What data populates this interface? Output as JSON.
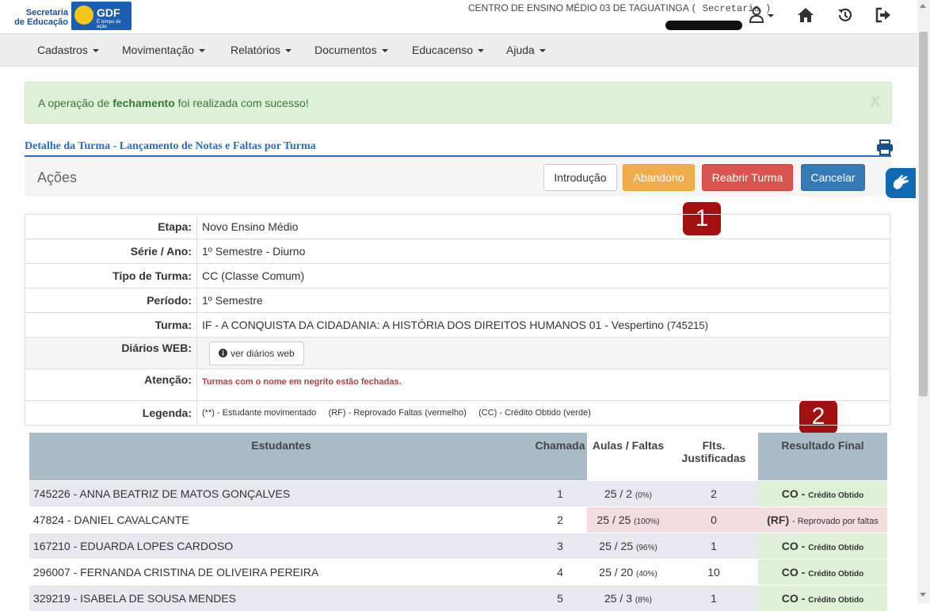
{
  "header": {
    "logo_secretaria_line1": "Secretaria",
    "logo_secretaria_line2": "de Educação",
    "logo_gdf": "GDF",
    "logo_gdf_tagline": "É tempo de ação",
    "school_name": "CENTRO DE ENSINO MÉDIO 03 DE TAGUATINGA",
    "role": "( Secretaria )"
  },
  "nav": [
    {
      "label": "Cadastros"
    },
    {
      "label": "Movimentação"
    },
    {
      "label": "Relatórios"
    },
    {
      "label": "Documentos"
    },
    {
      "label": "Educacenso"
    },
    {
      "label": "Ajuda"
    }
  ],
  "alert": {
    "prefix": "A operação de ",
    "bold": "fechamento",
    "suffix": " foi realizada com sucesso!",
    "close": "X"
  },
  "section_title": "Detalhe da Turma - Lançamento de Notas e Faltas por Turma",
  "actions": {
    "label": "Ações",
    "introducao": "Introdução",
    "abandono": "Abandono",
    "reabrir": "Reabrir Turma",
    "cancelar": "Cancelar"
  },
  "badges": {
    "one": "1",
    "two": "2"
  },
  "info": {
    "etapa_label": "Etapa:",
    "etapa": "Novo Ensino Médio",
    "serie_label": "Série / Ano:",
    "serie": "1º Semestre - Diurno",
    "tipo_label": "Tipo de Turma:",
    "tipo": "CC (Classe Comum)",
    "periodo_label": "Período:",
    "periodo": "1º Semestre",
    "turma_label": "Turma:",
    "turma": "IF - A CONQUISTA DA CIDADANIA: A HISTÓRIA DOS DIREITOS HUMANOS 01 - Vespertino",
    "turma_code": "(745215)",
    "diarios_label": "Diários WEB:",
    "diarios_button": "ver diários web",
    "atencao_label": "Atenção:",
    "atencao": "Turmas com o nome em negrito estão fechadas.",
    "legenda_label": "Legenda:",
    "legenda1": "(**) - Estudante movimentado",
    "legenda2": "(RF) - Reprovado Faltas (vermelho)",
    "legenda3": "(CC) - Crédito Obtido (verde)"
  },
  "grades": {
    "headers": {
      "estudantes": "Estudantes",
      "chamada": "Chamada",
      "aulas": "Aulas / Faltas",
      "flts1": "Flts.",
      "flts2": "Justificadas",
      "resultado": "Resultado Final"
    },
    "rows": [
      {
        "student": "745226 - ANNA BEATRIZ DE MATOS GONÇALVES",
        "chamada": "1",
        "aulas": "25 / 2",
        "pct": "(0%)",
        "flts": "2",
        "code": "CO -",
        "desc": "Crédito Obtido",
        "status": "co"
      },
      {
        "student": "47824 - DANIEL CAVALCANTE",
        "chamada": "2",
        "aulas": "25 / 25",
        "pct": "(100%)",
        "flts": "0",
        "code": "(RF)",
        "desc": "- Reprovado por faltas",
        "status": "rf"
      },
      {
        "student": "167210 - EDUARDA LOPES CARDOSO",
        "chamada": "3",
        "aulas": "25 / 25",
        "pct": "(96%)",
        "flts": "1",
        "code": "CO -",
        "desc": "Crédito Obtido",
        "status": "co"
      },
      {
        "student": "296007 - FERNANDA CRISTINA DE OLIVEIRA PEREIRA",
        "chamada": "4",
        "aulas": "25 / 20",
        "pct": "(40%)",
        "flts": "10",
        "code": "CO -",
        "desc": "Crédito Obtido",
        "status": "co"
      },
      {
        "student": "329219 - ISABELA DE SOUSA MENDES",
        "chamada": "5",
        "aulas": "25 / 3",
        "pct": "(8%)",
        "flts": "1",
        "code": "CO -",
        "desc": "Crédito Obtido",
        "status": "co"
      }
    ]
  }
}
